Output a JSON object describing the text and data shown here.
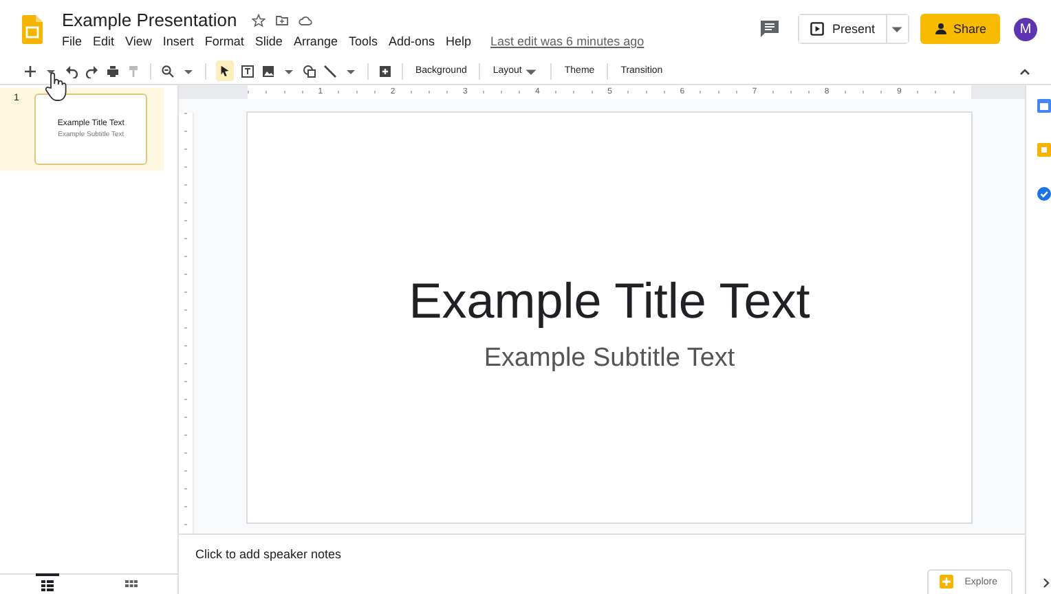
{
  "header": {
    "title": "Example Presentation",
    "menu": [
      "File",
      "Edit",
      "View",
      "Insert",
      "Format",
      "Slide",
      "Arrange",
      "Tools",
      "Add-ons",
      "Help"
    ],
    "last_edit": "Last edit was 6 minutes ago",
    "present": "Present",
    "share": "Share",
    "avatar": "M"
  },
  "toolbar": {
    "buttons": [
      {
        "label": "Background",
        "dropdown": false
      },
      {
        "label": "Layout",
        "dropdown": true
      },
      {
        "label": "Theme",
        "dropdown": false
      },
      {
        "label": "Transition",
        "dropdown": false
      }
    ]
  },
  "ruler": {
    "ticks": [
      "1",
      "2",
      "3",
      "4",
      "5",
      "6",
      "7",
      "8",
      "9"
    ]
  },
  "slides": [
    {
      "number": "1",
      "title": "Example Title Text",
      "subtitle": "Example Subtitle Text",
      "selected": true
    }
  ],
  "slide": {
    "title": "Example Title Text",
    "subtitle": "Example Subtitle Text"
  },
  "notes": {
    "placeholder": "Click to add speaker notes"
  },
  "explore": "Explore",
  "view_toggles": [
    {
      "selected": true
    },
    {
      "selected": false
    }
  ]
}
